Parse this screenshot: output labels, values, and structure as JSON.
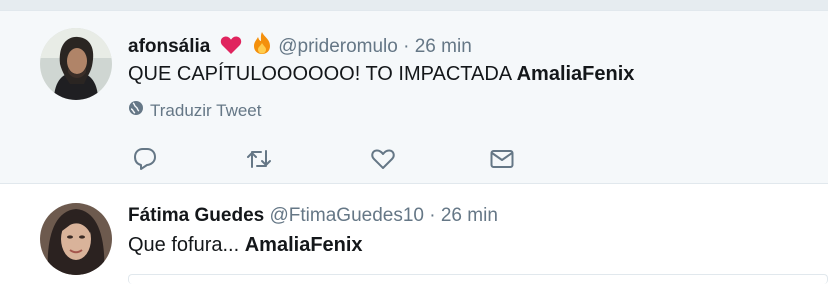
{
  "tweets": [
    {
      "fullname": "afonsália",
      "emoji_1": "red-heart",
      "emoji_2": "fire",
      "handle": "@prideromulo",
      "dot": "·",
      "time": "26 min",
      "text_prefix": "QUE CAPÍTULOOOOOO! TO IMPACTADA ",
      "mention": "AmaliaFenix",
      "translate": "Traduzir Tweet",
      "actions": [
        "reply-icon",
        "retweet-icon",
        "like-icon",
        "direct-message-icon"
      ]
    },
    {
      "fullname": "Fátima Guedes",
      "handle": "@FtimaGuedes10",
      "dot": "·",
      "time": "26 min",
      "text_prefix": "Que fofura... ",
      "mention": "AmaliaFenix"
    }
  ],
  "colors": {
    "background_highlight": "#f5f8fa",
    "secondary_text": "#657786",
    "heart": "#e0245e",
    "fire": "#f4900c"
  }
}
